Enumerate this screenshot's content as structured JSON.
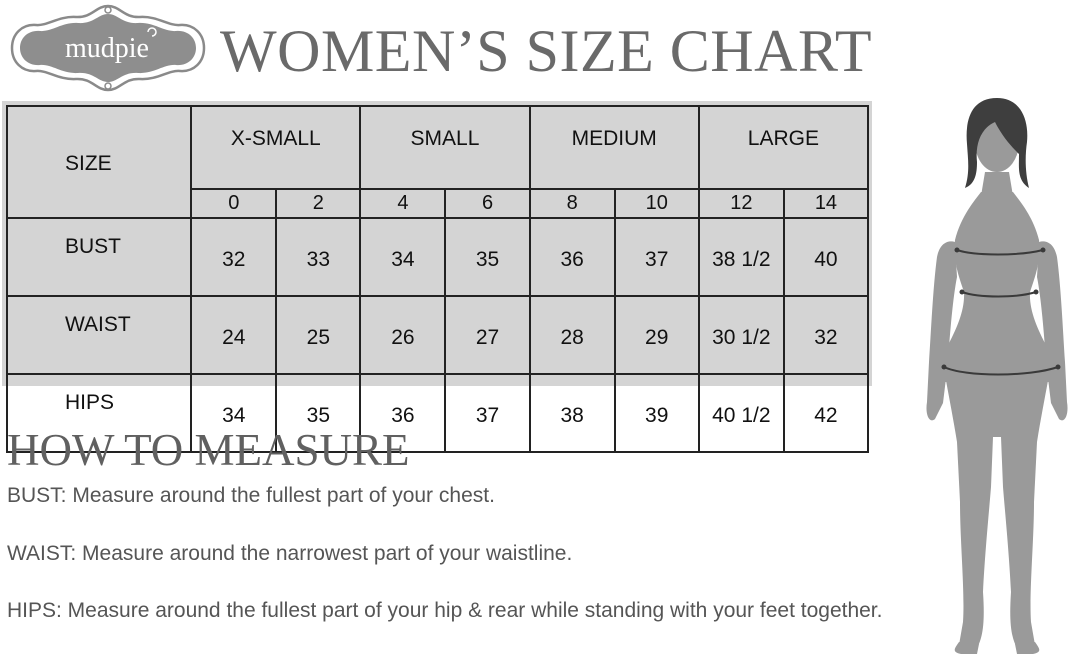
{
  "logo": {
    "text": "mudpie"
  },
  "title": "WOMEN’S SIZE CHART",
  "size_table": {
    "size_label": "SIZE",
    "groups": [
      "X-SMALL",
      "SMALL",
      "MEDIUM",
      "LARGE"
    ],
    "sizes": [
      "0",
      "2",
      "4",
      "6",
      "8",
      "10",
      "12",
      "14"
    ],
    "rows": [
      {
        "label": "BUST",
        "values": [
          "32",
          "33",
          "34",
          "35",
          "36",
          "37",
          "38 1/2",
          "40"
        ]
      },
      {
        "label": "WAIST",
        "values": [
          "24",
          "25",
          "26",
          "27",
          "28",
          "29",
          "30 1/2",
          "32"
        ]
      },
      {
        "label": "HIPS",
        "values": [
          "34",
          "35",
          "36",
          "37",
          "38",
          "39",
          "40 1/2",
          "42"
        ]
      }
    ]
  },
  "measure": {
    "heading": "HOW TO MEASURE",
    "bust": "BUST: Measure around the fullest part of your chest.",
    "waist": "WAIST: Measure around the narrowest part of your waistline.",
    "hips": "HIPS: Measure around the fullest part of your hip & rear while standing with your feet together."
  }
}
